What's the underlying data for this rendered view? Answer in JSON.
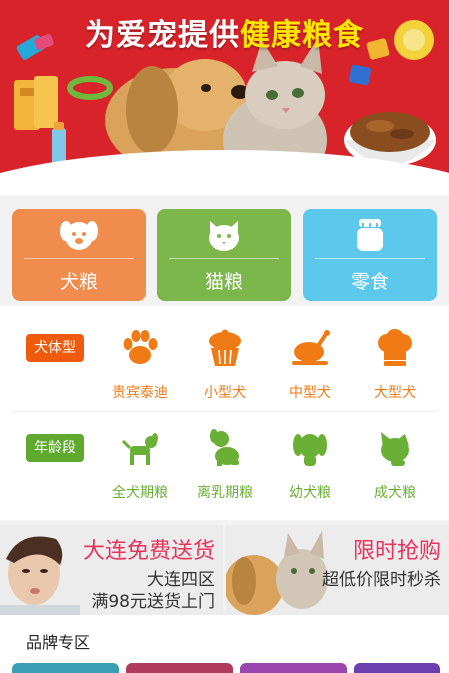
{
  "banner": {
    "title_part1": "为爱宠提供",
    "title_part2": "健康粮食",
    "colors": {
      "background": "#d8232a",
      "highlight": "#ffe600"
    }
  },
  "categories": [
    {
      "label": "犬粮",
      "icon": "dog-face-icon",
      "color": "#f08c4e"
    },
    {
      "label": "猫粮",
      "icon": "cat-face-icon",
      "color": "#7db64a"
    },
    {
      "label": "零食",
      "icon": "snack-jar-icon",
      "color": "#5bc8ec"
    }
  ],
  "size_filter": {
    "tag": "犬体型",
    "tag_color": "#f05a0c",
    "item_color": "#f07a14",
    "items": [
      {
        "label": "贵宾泰迪",
        "icon": "paw-icon"
      },
      {
        "label": "小型犬",
        "icon": "cupcake-icon"
      },
      {
        "label": "中型犬",
        "icon": "roast-chicken-icon"
      },
      {
        "label": "大型犬",
        "icon": "chef-hat-icon"
      }
    ]
  },
  "age_filter": {
    "tag": "年龄段",
    "tag_color": "#5fa92f",
    "item_color": "#6aaf36",
    "items": [
      {
        "label": "全犬期粮",
        "icon": "dog-standing-icon"
      },
      {
        "label": "离乳期粮",
        "icon": "puppy-sitting-icon"
      },
      {
        "label": "幼犬粮",
        "icon": "dog-head-icon"
      },
      {
        "label": "成犬粮",
        "icon": "cat-head-icon"
      }
    ]
  },
  "promos": [
    {
      "title": "大连免费送货",
      "line1": "大连四区",
      "line2": "满98元送货上门"
    },
    {
      "title": "限时抢购",
      "line1": "超低价限时秒杀"
    }
  ],
  "brand": {
    "title": "品牌专区",
    "tab_colors": [
      "#3a9fb5",
      "#b03a5e",
      "#9a46ae",
      "#6c3fb0"
    ]
  }
}
